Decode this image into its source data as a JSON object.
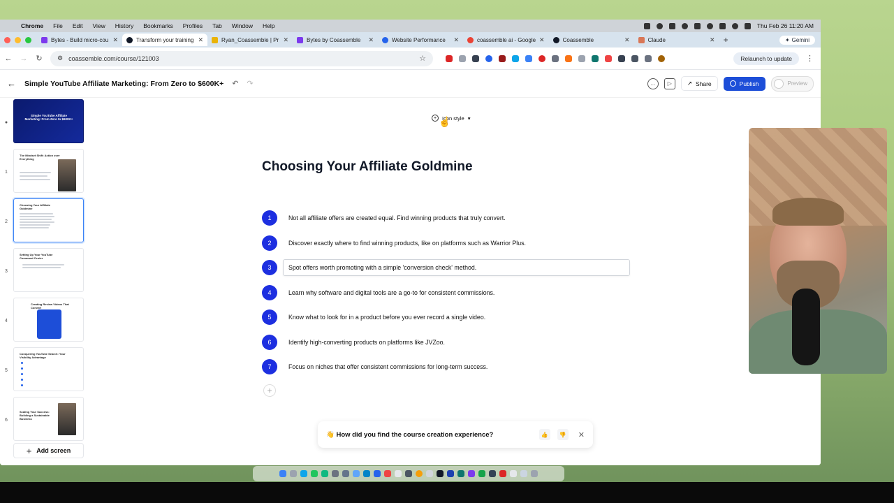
{
  "menubar": {
    "app": "Chrome",
    "items": [
      "File",
      "Edit",
      "View",
      "History",
      "Bookmarks",
      "Profiles",
      "Tab",
      "Window",
      "Help"
    ],
    "clock": "Thu Feb 26  11:20 AM"
  },
  "browser": {
    "tabs": [
      {
        "label": "Bytes - Build micro-cou",
        "color": "#7c3aed"
      },
      {
        "label": "Transform your training",
        "color": "#111827"
      },
      {
        "label": "Ryan_Coassemble | Pr",
        "color": "#eab308"
      },
      {
        "label": "Bytes by Coassemble",
        "color": "#7c3aed"
      },
      {
        "label": "Website Performance",
        "color": "#2563eb"
      },
      {
        "label": "coassemble ai - Google",
        "color": "#ea4335"
      },
      {
        "label": "Coassemble",
        "color": "#111827"
      },
      {
        "label": "Claude",
        "color": "#d97757"
      }
    ],
    "gemini": "Gemini",
    "url": "coassemble.com/course/121003",
    "relaunch": "Relaunch to update"
  },
  "header": {
    "course_title": "Simple YouTube Affiliate Marketing: From Zero to $600K+",
    "share": "Share",
    "publish": "Publish",
    "preview": "Preview"
  },
  "sidebar": {
    "screens": [
      {
        "num": "",
        "title": "Simple YouTube Affiliate Marketing: From Zero to $600K+"
      },
      {
        "num": "1",
        "title": "The Mindset Shift: Action over Everything"
      },
      {
        "num": "2",
        "title": "Choosing Your Affiliate Goldmine"
      },
      {
        "num": "3",
        "title": "Setting Up Your YouTube Command Center"
      },
      {
        "num": "4",
        "title": "Creating Review Videos That Convert"
      },
      {
        "num": "5",
        "title": "Conquering YouTube Search: Your Visibility Advantage"
      },
      {
        "num": "6",
        "title": "Scaling Your Success: Building a Sustainable Business"
      }
    ],
    "add_screen": "Add screen"
  },
  "canvas": {
    "icon_style": "Icon style",
    "title": "Choosing Your Affiliate Goldmine",
    "items": [
      {
        "n": "1",
        "text": "Not all affiliate offers are created equal. Find winning products that truly convert."
      },
      {
        "n": "2",
        "text": "Discover exactly where to find winning products, like on platforms such as Warrior Plus."
      },
      {
        "n": "3",
        "text": "Spot offers worth promoting with a simple 'conversion check' method."
      },
      {
        "n": "4",
        "text": "Learn why software and digital tools are a go-to for consistent commissions."
      },
      {
        "n": "5",
        "text": "Know what to look for in a product before you ever record a single video."
      },
      {
        "n": "6",
        "text": "Identify high-converting products on platforms like JVZoo."
      },
      {
        "n": "7",
        "text": "Focus on niches that offer consistent commissions for long-term success."
      }
    ],
    "feedback": "👋 How did you find the course creation experience?"
  },
  "colors": {
    "accent": "#1d2fe0",
    "publish": "#1d4ed8"
  }
}
